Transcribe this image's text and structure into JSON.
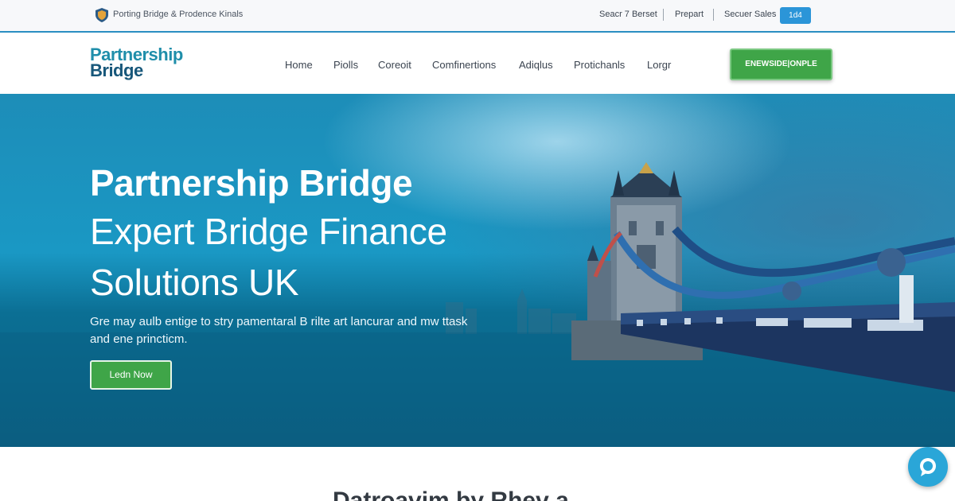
{
  "topbar": {
    "tagline": "Porting Bridge & Prodence Kinals",
    "links": [
      "Seacr 7 Berset",
      "Prepart",
      "Secuer Sales"
    ],
    "button_label": "1d4",
    "icon": "shield-icon"
  },
  "header": {
    "logo_line1": "Partnership",
    "logo_line2": "Bridge",
    "nav": [
      "Home",
      "Piolls",
      "Coreoit",
      "Comfinertions",
      "Adiqlus",
      "Protichanls",
      "Lorgr"
    ],
    "cta_label": "ENEWSIDE|ONPLE"
  },
  "hero": {
    "title_line1": "Partnership Bridge",
    "title_line2": "Expert Bridge Finance",
    "title_line3": "Solutions UK",
    "subtitle": "Gre may aulb entige to stry pamentaral B rilte art lancurar and mw ttask and ene princticm.",
    "button_label": "Ledn Now"
  },
  "section": {
    "title": "Datroavim by Rhev a"
  },
  "chat": {
    "icon": "chat-icon"
  },
  "colors": {
    "accent_blue": "#2b95d8",
    "brand_green": "#3fa548",
    "logo_teal": "#1f8eaa",
    "logo_navy": "#17577a"
  }
}
